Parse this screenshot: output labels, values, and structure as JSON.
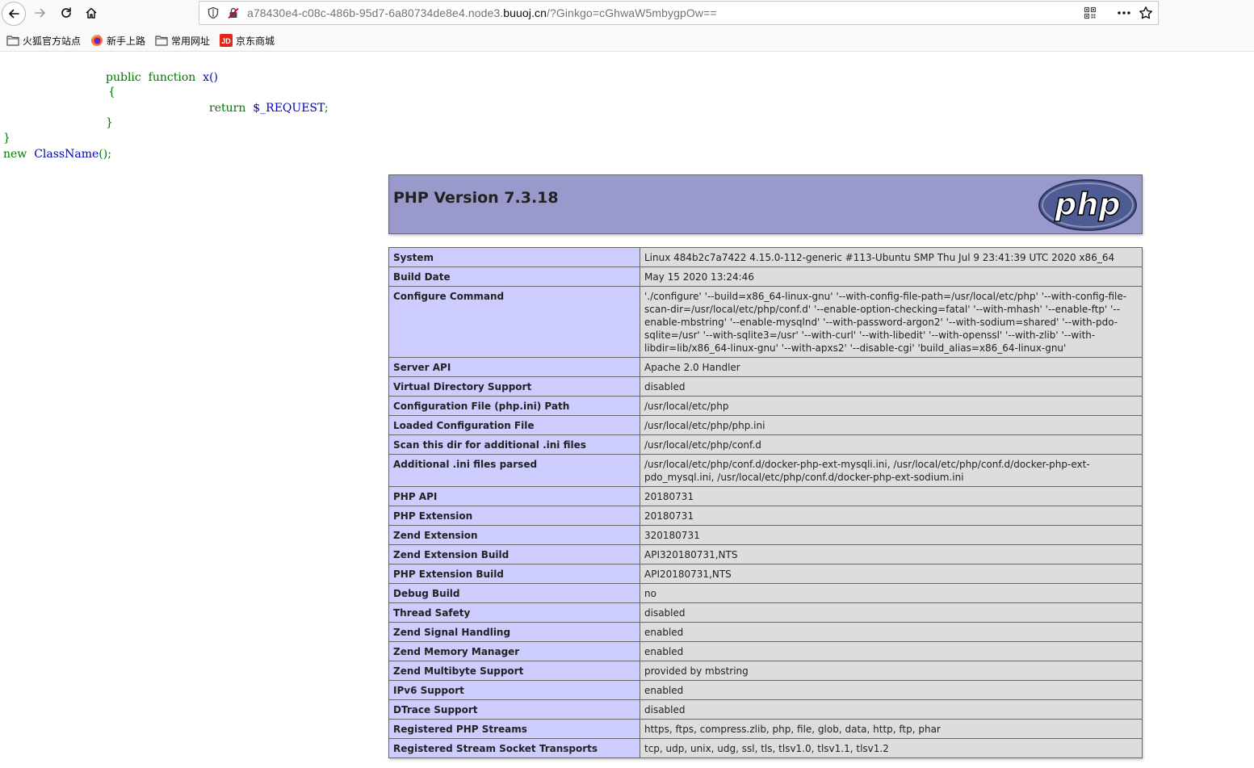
{
  "browser": {
    "url_prefix": "a78430e4-c08c-486b-95d7-6a80734de8e4.node3.",
    "url_domain": "buuoj.cn",
    "url_suffix": "/?Ginkgo=cGhwaW5mbygpOw==",
    "bookmarks": [
      {
        "label": "火狐官方站点",
        "icon": "folder-icon"
      },
      {
        "label": "新手上路",
        "icon": "firefox-icon"
      },
      {
        "label": "常用网址",
        "icon": "folder-icon"
      },
      {
        "label": "京东商城",
        "icon": "jd-icon"
      }
    ]
  },
  "source": {
    "line1_public": "public",
    "line1_function": "function",
    "line1_name": "x()",
    "line2": "{",
    "line3_return": "return",
    "line3_var": "$_REQUEST",
    "line3_semi": ";",
    "line4": "}",
    "line5": "}",
    "line6_new": "new",
    "line6_class": "ClassName",
    "line6_end": "();"
  },
  "phpinfo": {
    "title": "PHP Version 7.3.18",
    "logo_text": "php",
    "rows": [
      {
        "key": "System",
        "value": "Linux 484b2c7a7422 4.15.0-112-generic #113-Ubuntu SMP Thu Jul 9 23:41:39 UTC 2020 x86_64"
      },
      {
        "key": "Build Date",
        "value": "May 15 2020 13:24:46"
      },
      {
        "key": "Configure Command",
        "value": "'./configure' '--build=x86_64-linux-gnu' '--with-config-file-path=/usr/local/etc/php' '--with-config-file-scan-dir=/usr/local/etc/php/conf.d' '--enable-option-checking=fatal' '--with-mhash' '--enable-ftp' '--enable-mbstring' '--enable-mysqlnd' '--with-password-argon2' '--with-sodium=shared' '--with-pdo-sqlite=/usr' '--with-sqlite3=/usr' '--with-curl' '--with-libedit' '--with-openssl' '--with-zlib' '--with-libdir=lib/x86_64-linux-gnu' '--with-apxs2' '--disable-cgi' 'build_alias=x86_64-linux-gnu'"
      },
      {
        "key": "Server API",
        "value": "Apache 2.0 Handler"
      },
      {
        "key": "Virtual Directory Support",
        "value": "disabled"
      },
      {
        "key": "Configuration File (php.ini) Path",
        "value": "/usr/local/etc/php"
      },
      {
        "key": "Loaded Configuration File",
        "value": "/usr/local/etc/php/php.ini"
      },
      {
        "key": "Scan this dir for additional .ini files",
        "value": "/usr/local/etc/php/conf.d"
      },
      {
        "key": "Additional .ini files parsed",
        "value": "/usr/local/etc/php/conf.d/docker-php-ext-mysqli.ini, /usr/local/etc/php/conf.d/docker-php-ext-pdo_mysql.ini, /usr/local/etc/php/conf.d/docker-php-ext-sodium.ini"
      },
      {
        "key": "PHP API",
        "value": "20180731"
      },
      {
        "key": "PHP Extension",
        "value": "20180731"
      },
      {
        "key": "Zend Extension",
        "value": "320180731"
      },
      {
        "key": "Zend Extension Build",
        "value": "API320180731,NTS"
      },
      {
        "key": "PHP Extension Build",
        "value": "API20180731,NTS"
      },
      {
        "key": "Debug Build",
        "value": "no"
      },
      {
        "key": "Thread Safety",
        "value": "disabled"
      },
      {
        "key": "Zend Signal Handling",
        "value": "enabled"
      },
      {
        "key": "Zend Memory Manager",
        "value": "enabled"
      },
      {
        "key": "Zend Multibyte Support",
        "value": "provided by mbstring"
      },
      {
        "key": "IPv6 Support",
        "value": "enabled"
      },
      {
        "key": "DTrace Support",
        "value": "disabled"
      },
      {
        "key": "Registered PHP Streams",
        "value": "https, ftps, compress.zlib, php, file, glob, data, http, ftp, phar"
      },
      {
        "key": "Registered Stream Socket Transports",
        "value": "tcp, udp, unix, udg, ssl, tls, tlsv1.0, tlsv1.1, tlsv1.2"
      }
    ]
  }
}
